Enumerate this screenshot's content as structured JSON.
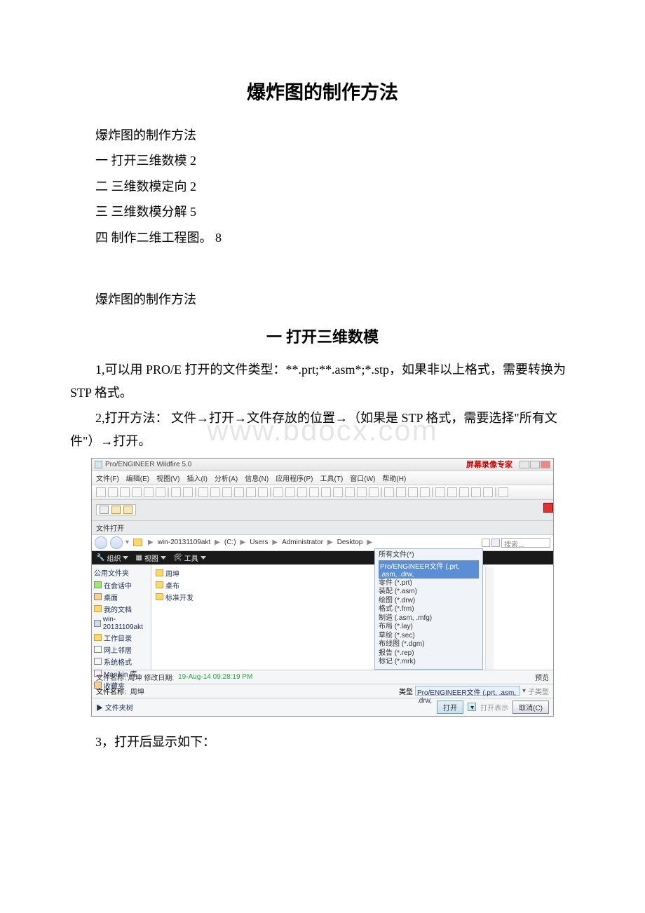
{
  "doc": {
    "title": "爆炸图的制作方法",
    "para1": "爆炸图的制作方法",
    "toc1": "一 打开三维数模 2",
    "toc2": "二 三维数模定向 2",
    "toc3": "三 三维数模分解 5",
    "toc4": "四 制作二维工程图。 8",
    "para2": "爆炸图的制作方法",
    "subtitle1": "一 打开三维数模",
    "body1": "1,可以用 PRO/E 打开的文件类型：**.prt;**.asm*;*.stp，如果非以上格式，需要转换为 STP 格式。",
    "body2": "2,打开方法： 文件→打开→文件存放的位置→（如果是 STP 格式，需要选择\"所有文件\"）→打开。",
    "body3": "3，打开后显示如下：",
    "watermark": "www.bdocx.com"
  },
  "shot": {
    "appTitle": "Pro/ENGINEER Wildfire 5.0",
    "recorder": "屏幕录像专家",
    "menus": [
      "文件(F)",
      "编辑(E)",
      "视图(V)",
      "插入(I)",
      "分析(A)",
      "信息(N)",
      "应用程序(P)",
      "工具(T)",
      "窗口(W)",
      "帮助(H)"
    ],
    "dlgTitle": "文件打开",
    "breadcrumbs": [
      "win-20131109akt",
      "(C:)",
      "Users",
      "Administrator",
      "Desktop"
    ],
    "searchPlaceholder": "搜索...",
    "blackbar": {
      "organize": "组织",
      "views": "视图",
      "tools": "工具"
    },
    "sidebar": {
      "header": "公用文件夹",
      "items": [
        "在会话中",
        "桌面",
        "我的文档",
        "win-20131109akt",
        "工作目录",
        "网上邻居",
        "系统格式",
        "Manikin 库",
        "收藏夹"
      ]
    },
    "files": [
      "周坤",
      "桌布",
      "标准开发"
    ],
    "filetype": {
      "header": "所有文件(*)",
      "highlight": "Pro/ENGINEER文件 (.prt, .asm, .drw,",
      "lines": [
        "零件 (*.prt)",
        "装配 (*.asm)",
        "绘图 (*.drw)",
        "格式 (*.frm)",
        "制造 (.asm, .mfg)",
        "布局 (*.lay)",
        "草绘 (*.sec)",
        "布线图 (*.dgm)",
        "报告 (*.rep)",
        "标记 (*.mrk)"
      ]
    },
    "metaRow": {
      "label": "文件名称: 周坤  修改日期:",
      "date": "19-Aug-14 09:28:19 PM",
      "preview": "预览"
    },
    "fileRow": {
      "label": "文件名称:",
      "value": "周坤",
      "typelabel": "类型",
      "typevalue": "Pro/ENGINEER文件 (.prt, .asm, .drw,",
      "subtype": "子类型"
    },
    "footer": {
      "tree": "▶ 文件夹树",
      "open": "打开",
      "openrep": "打开表示",
      "cancel": "取消(C)"
    }
  }
}
